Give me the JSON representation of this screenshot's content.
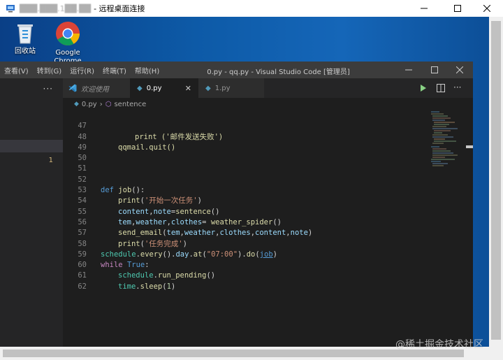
{
  "rdp": {
    "host": "███.███.1██.██",
    "title": "- 远程桌面连接"
  },
  "desktop": {
    "icons": [
      {
        "label": "回收站",
        "icon": "recycle-bin-icon"
      },
      {
        "label": "Google Chrome",
        "icon": "chrome-icon"
      }
    ]
  },
  "vscode": {
    "title": "0.py - qq.py - Visual Studio Code [管理员]",
    "menu": [
      "查看(V)",
      "转到(G)",
      "运行(R)",
      "终端(T)",
      "帮助(H)"
    ],
    "tabs": [
      {
        "label": "欢迎使用",
        "icon": "vscode-icon"
      },
      {
        "label": "0.py",
        "icon": "python-file-icon"
      },
      {
        "label": "1.py",
        "icon": "python-file-icon"
      }
    ],
    "breadcrumb": {
      "file": "0.py",
      "symbol": "sentence"
    },
    "sidebar_count": "1",
    "code": {
      "l47": "47",
      "t47": "print ('邮件发送失败')",
      "l48": "48",
      "t48": "qqmail.quit()",
      "l49": "49",
      "l50": "50",
      "l51": "51",
      "l52": "52",
      "t52a": "def",
      "t52b": "job",
      "l53": "53",
      "t53a": "print",
      "t53b": "'开始一次任务'",
      "l54": "54",
      "t54a": "content",
      "t54b": "note",
      "t54c": "sentence",
      "l55": "55",
      "t55a": "tem",
      "t55b": "weather",
      "t55c": "clothes",
      "t55d": "weather_spider",
      "l56": "56",
      "t56a": "send_email",
      "t56b": "tem",
      "t56c": "weather",
      "t56d": "clothes",
      "t56e": "content",
      "t56f": "note",
      "l57": "57",
      "t57a": "print",
      "t57b": "'任务完成'",
      "l58": "58",
      "t58a": "schedule",
      "t58b": "every",
      "t58c": "day",
      "t58d": "at",
      "t58e": "\"07:00\"",
      "t58f": "do",
      "t58g": "job",
      "l59": "59",
      "t59a": "while",
      "t59b": "True",
      "l60": "60",
      "t60a": "schedule",
      "t60b": "run_pending",
      "l61": "61",
      "t61a": "time",
      "t61b": "sleep",
      "t61c": "1",
      "l62": "62"
    }
  },
  "watermark": "@稀土掘金技术社区",
  "colors": {
    "vscode_bg": "#1e1e1e",
    "menubar": "#3c3c3c",
    "keyword": "#569cd6",
    "function": "#dcdcaa",
    "string": "#ce9178"
  }
}
